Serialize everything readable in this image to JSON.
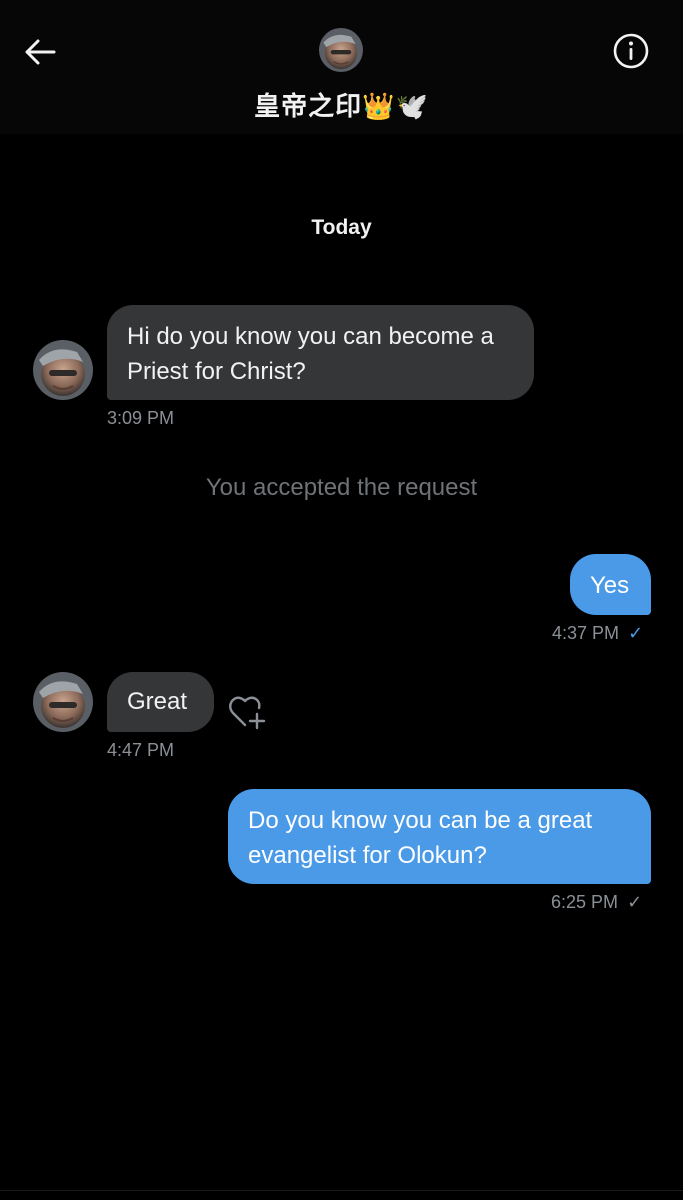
{
  "header": {
    "title": "皇帝之印👑🕊️",
    "back_icon": "arrow-left-icon",
    "info_icon": "info-icon"
  },
  "conversation": {
    "day_label": "Today",
    "system_message": "You accepted the request",
    "messages": [
      {
        "direction": "incoming",
        "text": "Hi do you know you can become a Priest for Christ?",
        "time": "3:09 PM"
      },
      {
        "direction": "outgoing",
        "text": "Yes",
        "time": "4:37 PM",
        "status_icon": "check-icon",
        "status_color": "#4a9ae8"
      },
      {
        "direction": "incoming",
        "text": "Great",
        "time": "4:47 PM",
        "reaction_icon": "heart-plus-icon"
      },
      {
        "direction": "outgoing",
        "text": "Do you know you can be a great evangelist  for Olokun?",
        "time": "6:25 PM",
        "status_icon": "check-icon",
        "status_color": "#8b9096"
      }
    ]
  },
  "colors": {
    "background": "#000000",
    "incoming_bubble": "#343638",
    "outgoing_bubble": "#4a9ae8",
    "timestamp": "#8b9096",
    "system_text": "#6e7378"
  }
}
